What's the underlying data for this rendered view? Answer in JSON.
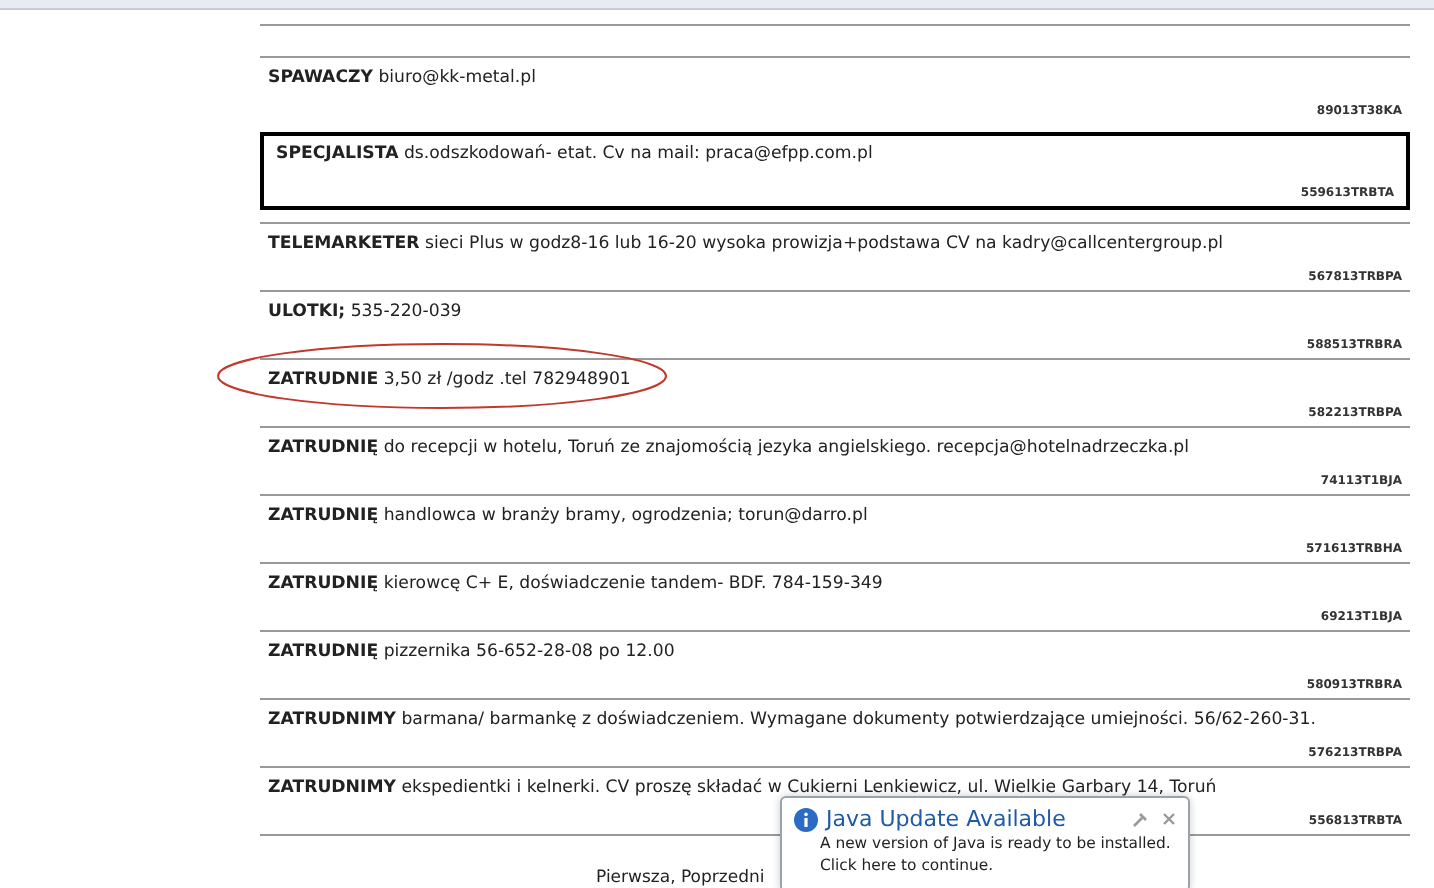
{
  "listings": [
    {
      "title": "SPAWACZY",
      "text": "biuro@kk-metal.pl",
      "code": "89013T38KA",
      "highlighted": false,
      "circled": false
    },
    {
      "title": "SPECJALISTA",
      "text": "ds.odszkodowań- etat. Cv na mail: praca@efpp.com.pl",
      "code": "559613TRBTA",
      "highlighted": true,
      "circled": false
    },
    {
      "title": "TELEMARKETER",
      "text": "sieci Plus w godz8-16 lub 16-20 wysoka prowizja+podstawa CV na kadry@callcentergroup.pl",
      "code": "567813TRBPA",
      "highlighted": false,
      "circled": false
    },
    {
      "title": "ULOTKI;",
      "text": "535-220-039",
      "code": "588513TRBRA",
      "highlighted": false,
      "circled": false
    },
    {
      "title": "ZATRUDNIE",
      "text": "3,50 zł /godz .tel 782948901",
      "code": "582213TRBPA",
      "highlighted": false,
      "circled": true
    },
    {
      "title": "ZATRUDNIĘ",
      "text": "do recepcji w hotelu, Toruń ze znajomością jezyka angielskiego. recepcja@hotelnadrzeczka.pl",
      "code": "74113T1BJA",
      "highlighted": false,
      "circled": false
    },
    {
      "title": "ZATRUDNIĘ",
      "text": "handlowca w branży bramy, ogrodzenia; torun@darro.pl",
      "code": "571613TRBHA",
      "highlighted": false,
      "circled": false
    },
    {
      "title": "ZATRUDNIĘ",
      "text": "kierowcę C+ E, doświadczenie tandem- BDF. 784-159-349",
      "code": "69213T1BJA",
      "highlighted": false,
      "circled": false
    },
    {
      "title": "ZATRUDNIĘ",
      "text": "pizzernika 56-652-28-08 po 12.00",
      "code": "580913TRBRA",
      "highlighted": false,
      "circled": false
    },
    {
      "title": "ZATRUDNIMY",
      "text": "barmana/ barmankę z doświadczeniem. Wymagane dokumenty potwierdzające umiejności. 56/62-260-31.",
      "code": "576213TRBPA",
      "highlighted": false,
      "circled": false
    },
    {
      "title": "ZATRUDNIMY",
      "text": "ekspedientki i kelnerki. CV proszę składać w Cukierni Lenkiewicz, ul. Wielkie Garbary 14, Toruń",
      "code": "556813TRBTA",
      "highlighted": false,
      "circled": false
    }
  ],
  "pagination": "Pierwsza, Poprzedni",
  "notification": {
    "title": "Java Update Available",
    "message": "A new version of Java is ready to be installed.",
    "action": "Click here to continue."
  }
}
